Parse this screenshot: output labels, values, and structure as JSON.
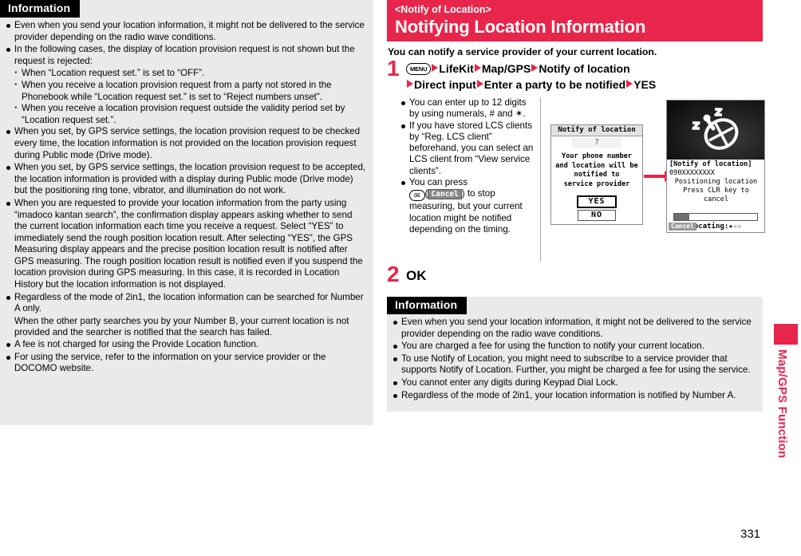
{
  "colors": {
    "accent_red": "#e8254a",
    "info_bg": "#eaeaea",
    "header_bg": "#000000"
  },
  "left_info": {
    "header": "Information",
    "items": [
      {
        "type": "bullet",
        "text": "Even when you send your location information, it might not be delivered to the service provider depending on the radio wave conditions."
      },
      {
        "type": "bullet",
        "text": "In the following cases, the display of location provision request is not shown but the request is rejected:"
      },
      {
        "type": "sub",
        "text": "When “Location request set.” is set to “OFF”."
      },
      {
        "type": "sub",
        "text": "When you receive a location provision request from a party not stored in the Phonebook while “Location request set.” is set to “Reject numbers unset”."
      },
      {
        "type": "sub",
        "text": "When you receive a location provision request outside the validity period set by “Location request set.”."
      },
      {
        "type": "bullet",
        "text": "When you set, by GPS service settings, the location provision request to be checked every time, the location information is not provided on the location provision request during Public mode (Drive mode)."
      },
      {
        "type": "bullet",
        "text": "When you set, by GPS service settings, the location provision request to be accepted, the location information is provided with a display during Public mode (Drive mode) but the positioning ring tone, vibrator, and illumination do not work."
      },
      {
        "type": "bullet",
        "text": "When you are requested to provide your location information from the party using “imadoco kantan search”, the confirmation display appears asking whether to send the current location information each time you receive a request. Select “YES” to immediately send the rough position location result. After selecting “YES”, the GPS Measuring display appears and the precise position location result is notified after GPS measuring. The rough position location result is notified even if you suspend the location provision during GPS measuring. In this case, it is recorded in Location History but the location information is not displayed."
      },
      {
        "type": "bullet",
        "text": "Regardless of the mode of 2in1, the location information can be searched for Number A only."
      },
      {
        "type": "plain",
        "text": "When the other party searches you by your Number B, your current location is not provided and the searcher is notified that the search has failed."
      },
      {
        "type": "bullet",
        "text": "A fee is not charged for using the Provide Location function."
      },
      {
        "type": "bullet",
        "text": "For using the service, refer to the information on your service provider or the DOCOMO website."
      }
    ]
  },
  "right": {
    "title_sub": "<Notify of Location>",
    "title_main": "Notifying Location Information",
    "intro": "You can notify a service provider of your current location.",
    "step1": {
      "number": "1",
      "key_label": "MENU",
      "line1_parts": [
        "LifeKit",
        "Map/GPS",
        "Notify of location"
      ],
      "line2_parts": [
        "Direct input",
        "Enter a party to be notified",
        "YES"
      ]
    },
    "step2": {
      "number": "2",
      "label": "OK"
    },
    "notes": [
      {
        "text": "You can enter up to 12 digits by using numerals, # and ✶."
      },
      {
        "text": "If you have stored LCS clients by “Reg. LCS client” beforehand, you can select an LCS client from “View service clients”."
      },
      {
        "pre": "You can press",
        "mail_key": "✉",
        "cancel_chip": "Cancel",
        "post": ") to stop measuring, but your current location might be notified depending on the timing."
      }
    ]
  },
  "screen1": {
    "title": "Notify of location",
    "question": "?",
    "message_lines": [
      "Your phone number",
      "and location will be",
      "notified to",
      "service provider"
    ],
    "yes": "YES",
    "no": "NO"
  },
  "screen2": {
    "header": "[Notify of location]",
    "number": "090XXXXXXXX",
    "status_line1": "Positioning location",
    "status_line2": "Press CLR key to cancel",
    "progress_percent": 18,
    "locating_label": "Locating:",
    "stars": "★☆☆",
    "softkey_cancel": "Cancel"
  },
  "right_info": {
    "header": "Information",
    "items": [
      {
        "type": "bullet",
        "text": "Even when you send your location information, it might not be delivered to the service provider depending on the radio wave conditions."
      },
      {
        "type": "bullet",
        "text": "You are charged a fee for using the function to notify your current location."
      },
      {
        "type": "bullet",
        "text": "To use Notify of Location, you might need to subscribe to a service provider that supports Notify of Location. Further, you might be charged a fee for using the service."
      },
      {
        "type": "bullet",
        "text": "You cannot enter any digits during Keypad Dial Lock."
      },
      {
        "type": "bullet",
        "text": "Regardless of the mode of 2in1, your location information is notified by Number A."
      }
    ]
  },
  "sidebar": {
    "label": "Map/GPS Function"
  },
  "page_number": "331"
}
